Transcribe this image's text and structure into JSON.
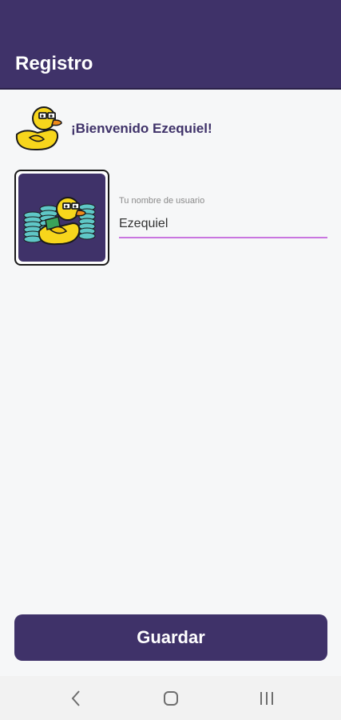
{
  "app_bar": {
    "title": "Registro"
  },
  "welcome": {
    "text": "¡Bienvenido Ezequiel!",
    "icon": "duck-glasses-icon"
  },
  "profile": {
    "avatar_icon": "duck-money-avatar",
    "username_label": "Tu nombre de usuario",
    "username_value": "Ezequiel"
  },
  "actions": {
    "save_label": "Guardar"
  },
  "system_nav": {
    "back": "back-icon",
    "home": "home-icon",
    "recents": "recents-icon"
  },
  "colors": {
    "primary": "#3f3269",
    "accent_underline": "#c976e0",
    "background": "#f6f7f8",
    "duck_yellow": "#f7d61c"
  }
}
